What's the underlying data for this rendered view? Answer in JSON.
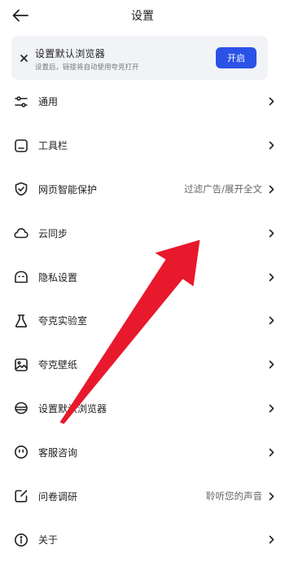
{
  "header": {
    "title": "设置",
    "back_icon": "back-arrow-icon"
  },
  "banner": {
    "title": "设置默认浏览器",
    "subtitle": "设置后，链接将自动使用夸克打开",
    "button_label": "开启",
    "close_icon": "close-icon",
    "accent_color": "#2b52e6"
  },
  "settings": {
    "items": [
      {
        "label": "通用",
        "value": "",
        "icon": "sliders-icon"
      },
      {
        "label": "工具栏",
        "value": "",
        "icon": "toolbar-icon"
      },
      {
        "label": "网页智能保护",
        "value": "过滤广告/展开全文",
        "icon": "shield-check-icon"
      },
      {
        "label": "云同步",
        "value": "",
        "icon": "cloud-icon"
      },
      {
        "label": "隐私设置",
        "value": "",
        "icon": "privacy-mask-icon"
      },
      {
        "label": "夸克实验室",
        "value": "",
        "icon": "flask-icon"
      },
      {
        "label": "夸克壁纸",
        "value": "",
        "icon": "image-icon"
      },
      {
        "label": "设置默认浏览器",
        "value": "",
        "icon": "browser-stack-icon"
      },
      {
        "label": "客服咨询",
        "value": "",
        "icon": "support-face-icon"
      },
      {
        "label": "问卷调研",
        "value": "聆听您的声音",
        "icon": "edit-survey-icon"
      },
      {
        "label": "关于",
        "value": "",
        "icon": "info-icon"
      }
    ]
  },
  "annotation": {
    "color": "#e8192c",
    "type": "arrow"
  }
}
